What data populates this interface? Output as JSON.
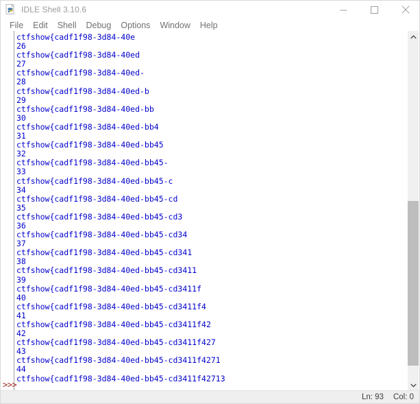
{
  "window": {
    "title": "IDLE Shell 3.10.6",
    "app_icon": "python-idle-icon",
    "controls": {
      "minimize": "minimize-icon",
      "maximize": "maximize-icon",
      "close": "close-icon"
    }
  },
  "menubar": {
    "items": [
      {
        "label": "File"
      },
      {
        "label": "Edit"
      },
      {
        "label": "Shell"
      },
      {
        "label": "Debug"
      },
      {
        "label": "Options"
      },
      {
        "label": "Window"
      },
      {
        "label": "Help"
      }
    ]
  },
  "shell": {
    "prompt": ">>>",
    "text_color": "#0000cc",
    "prompt_color": "#9b2020",
    "lines": [
      "ctfshow{cadf1f98-3d84-40e",
      "26",
      "ctfshow{cadf1f98-3d84-40ed",
      "27",
      "ctfshow{cadf1f98-3d84-40ed-",
      "28",
      "ctfshow{cadf1f98-3d84-40ed-b",
      "29",
      "ctfshow{cadf1f98-3d84-40ed-bb",
      "30",
      "ctfshow{cadf1f98-3d84-40ed-bb4",
      "31",
      "ctfshow{cadf1f98-3d84-40ed-bb45",
      "32",
      "ctfshow{cadf1f98-3d84-40ed-bb45-",
      "33",
      "ctfshow{cadf1f98-3d84-40ed-bb45-c",
      "34",
      "ctfshow{cadf1f98-3d84-40ed-bb45-cd",
      "35",
      "ctfshow{cadf1f98-3d84-40ed-bb45-cd3",
      "36",
      "ctfshow{cadf1f98-3d84-40ed-bb45-cd34",
      "37",
      "ctfshow{cadf1f98-3d84-40ed-bb45-cd341",
      "38",
      "ctfshow{cadf1f98-3d84-40ed-bb45-cd3411",
      "39",
      "ctfshow{cadf1f98-3d84-40ed-bb45-cd3411f",
      "40",
      "ctfshow{cadf1f98-3d84-40ed-bb45-cd3411f4",
      "41",
      "ctfshow{cadf1f98-3d84-40ed-bb45-cd3411f42",
      "42",
      "ctfshow{cadf1f98-3d84-40ed-bb45-cd3411f427",
      "43",
      "ctfshow{cadf1f98-3d84-40ed-bb45-cd3411f4271",
      "44",
      "ctfshow{cadf1f98-3d84-40ed-bb45-cd3411f42713"
    ]
  },
  "scrollbar": {
    "up_icon": "chevron-up-icon",
    "down_icon": "chevron-down-icon",
    "thumb_top_pct": 47,
    "thumb_height_pct": 49
  },
  "statusbar": {
    "line": "Ln: 93",
    "col": "Col: 0"
  }
}
